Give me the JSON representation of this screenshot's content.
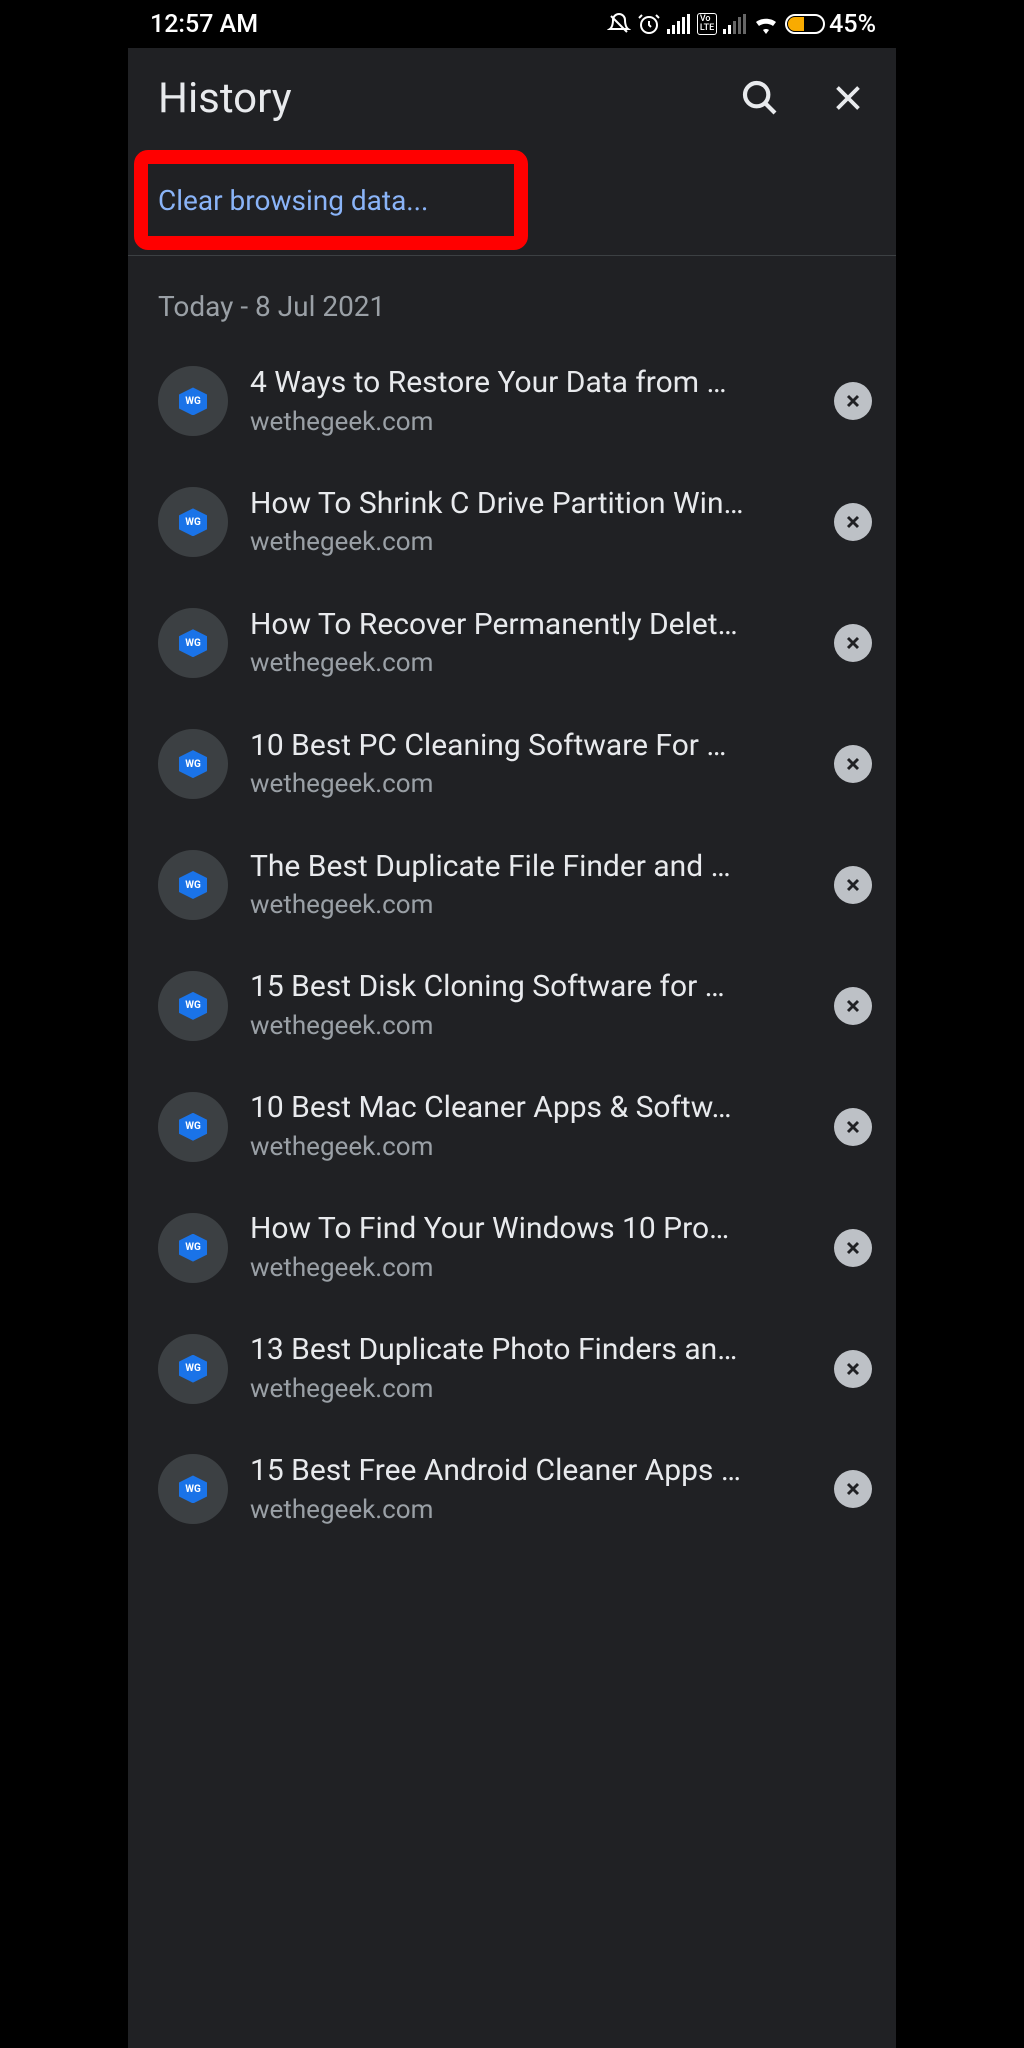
{
  "status": {
    "time": "12:57 AM",
    "battery_pct": "45%",
    "icons": {
      "mute": "bell-off-icon",
      "alarm": "alarm-icon",
      "signal1": "signal-icon",
      "volte": "volte-icon",
      "signal2": "signal-dim-icon",
      "wifi": "wifi-icon",
      "battery": "battery-icon"
    }
  },
  "header": {
    "title": "History",
    "search_icon": "search-icon",
    "close_icon": "close-icon"
  },
  "clear_action": {
    "label": "Clear browsing data...",
    "highlighted": true,
    "highlight_color": "#ff0000"
  },
  "history": {
    "date_header": "Today - 8 Jul 2021",
    "items": [
      {
        "title": "4 Ways to Restore Your Data from …",
        "domain": "wethegeek.com",
        "favicon": "WG"
      },
      {
        "title": "How To Shrink C Drive Partition Win…",
        "domain": "wethegeek.com",
        "favicon": "WG"
      },
      {
        "title": "How To Recover Permanently Delet…",
        "domain": "wethegeek.com",
        "favicon": "WG"
      },
      {
        "title": "10 Best PC Cleaning Software For …",
        "domain": "wethegeek.com",
        "favicon": "WG"
      },
      {
        "title": "The Best Duplicate File Finder and …",
        "domain": "wethegeek.com",
        "favicon": "WG"
      },
      {
        "title": "15 Best Disk Cloning Software for …",
        "domain": "wethegeek.com",
        "favicon": "WG"
      },
      {
        "title": "10 Best Mac Cleaner Apps & Softw…",
        "domain": "wethegeek.com",
        "favicon": "WG"
      },
      {
        "title": "How To Find Your Windows 10 Pro…",
        "domain": "wethegeek.com",
        "favicon": "WG"
      },
      {
        "title": "13 Best Duplicate Photo Finders an…",
        "domain": "wethegeek.com",
        "favicon": "WG"
      },
      {
        "title": "15 Best Free Android Cleaner Apps …",
        "domain": "wethegeek.com",
        "favicon": "WG"
      }
    ]
  },
  "colors": {
    "bg": "#202124",
    "link": "#8ab4f8",
    "muted": "#9aa0a6",
    "highlight": "#ff0000",
    "battery_fill": "#f9ab00"
  }
}
